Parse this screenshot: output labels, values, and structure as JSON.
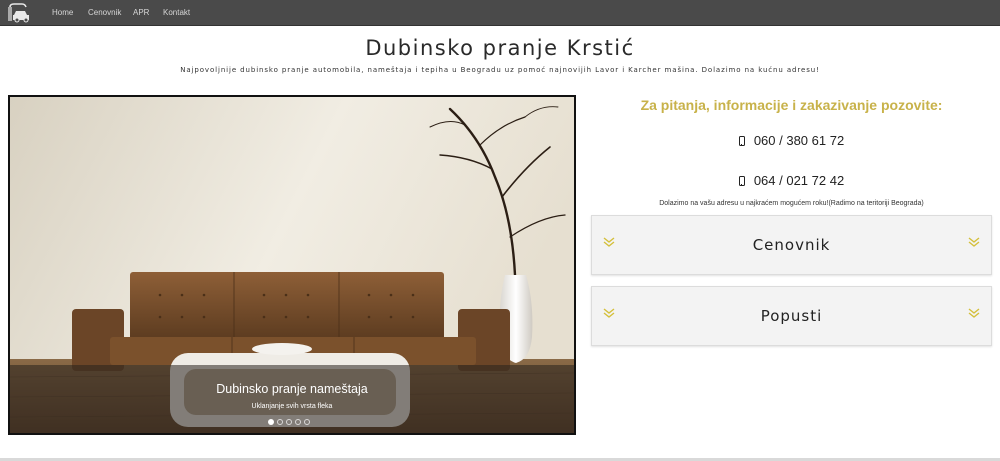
{
  "navbar": {
    "logo_icon": "car-wash-icon",
    "links": [
      "Home",
      "Cenovnik",
      "APR",
      "Kontakt"
    ]
  },
  "header": {
    "title": "Dubinsko pranje Krstić",
    "subtitle": "Najpovoljnije dubinsko pranje automobila, nameštaja i tepiha u Beogradu uz pomoć najnovijih Lavor i Karcher mašina. Dolazimo na kućnu adresu!"
  },
  "slider": {
    "caption_title": "Dubinsko pranje nameštaja",
    "caption_subtitle": "Uklanjanje svih vrsta fleka",
    "slide_count": 5,
    "active_slide": 1
  },
  "contact": {
    "title": "Za pitanja, informacije i zakazivanje pozovite:",
    "phones": [
      "060 / 380 61 72",
      "064 / 021 72 42"
    ],
    "phone_icon": "mobile-phone-icon",
    "note": "Dolazimo na vašu adresu u najkraćem mogućem roku!(Radimo na teritoriji Beograda)"
  },
  "accordions": [
    {
      "label": "Cenovnik",
      "icon": "double-chevron-down-icon"
    },
    {
      "label": "Popusti",
      "icon": "double-chevron-down-icon"
    }
  ],
  "colors": {
    "navbar": "#4a4a4a",
    "accent": "#c8b24a",
    "panel": "#f3f3f3"
  }
}
